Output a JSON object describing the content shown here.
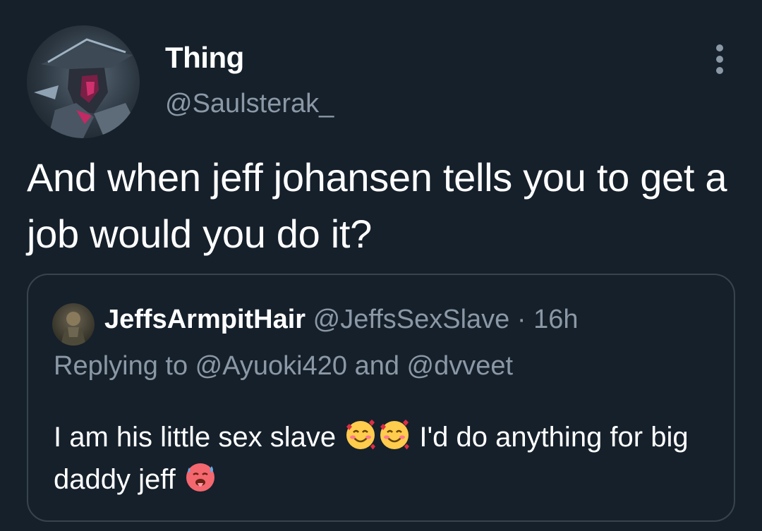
{
  "tweet": {
    "display_name": "Thing",
    "handle": "@Saulsterak_",
    "text": "And when jeff johansen tells you to get a job would you do it?",
    "more_icon": "more-vertical-icon"
  },
  "quoted_tweet": {
    "display_name": "JeffsArmpitHair",
    "handle_and_time": " @JeffsSexSlave · 16h",
    "replying_to": "Replying to @Ayuoki420 and @dvveet",
    "text_part1": "I am his little sex slave ",
    "text_part2": " I'd do anything for big daddy jeff ",
    "emojis": [
      "smiling-face-with-hearts",
      "smiling-face-with-hearts",
      "hot-face"
    ]
  },
  "colors": {
    "background": "#15202b",
    "secondary_text": "#8b98a5",
    "border": "#38444d"
  }
}
